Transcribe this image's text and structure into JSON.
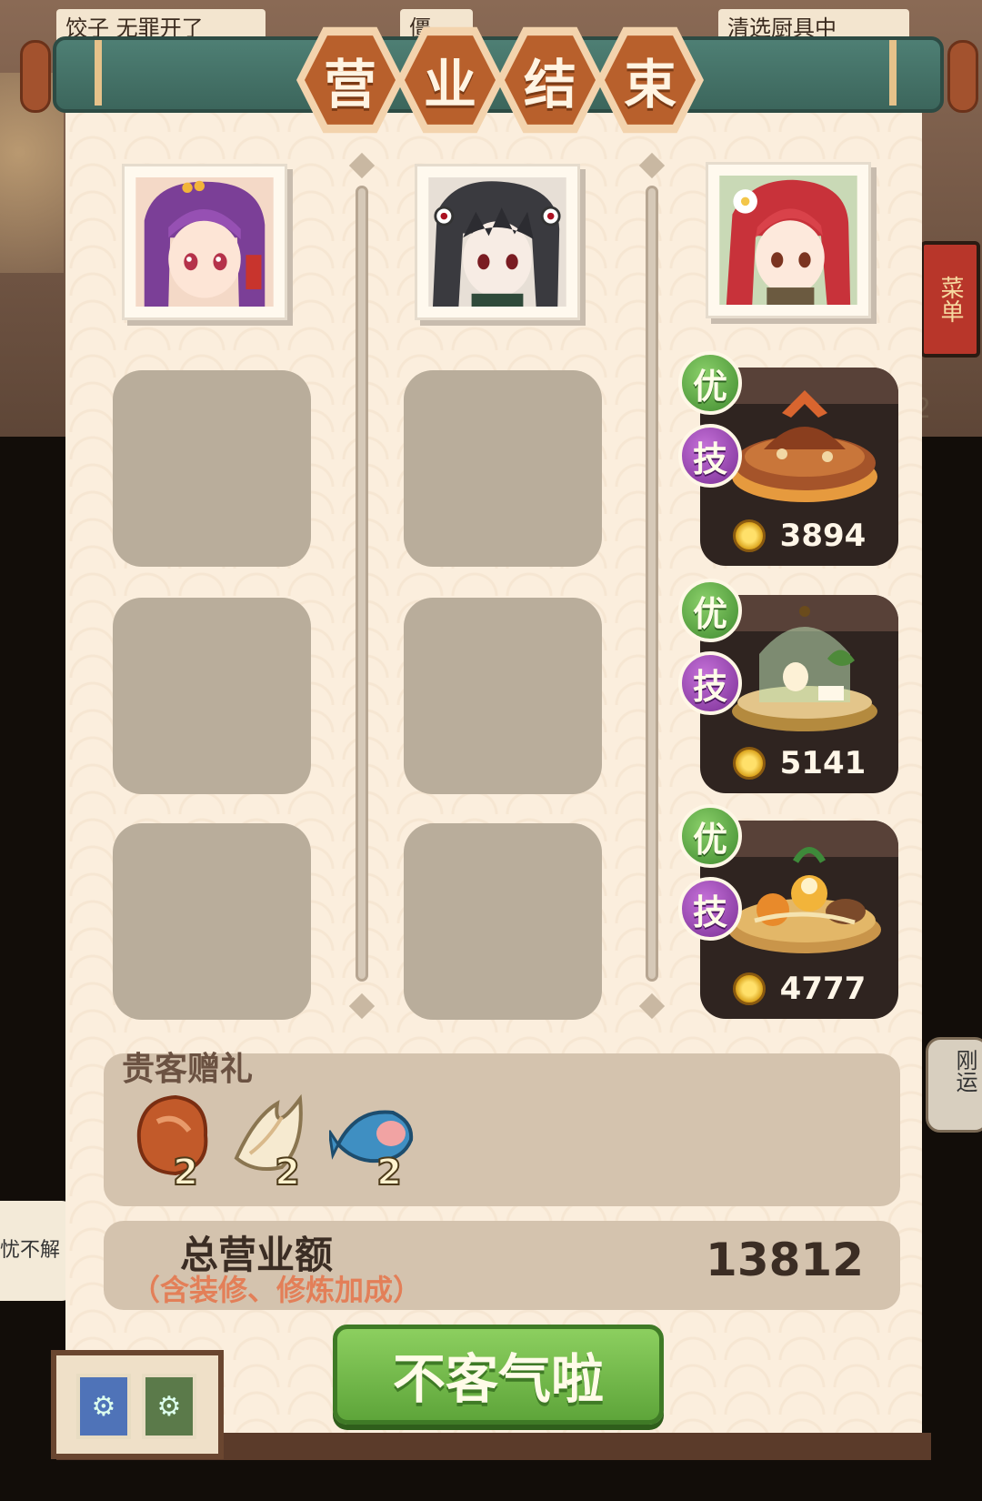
{
  "title": {
    "chars": [
      "营",
      "业",
      "结",
      "束"
    ]
  },
  "background": {
    "sign_left": "饺子 无罪开了",
    "sign_mid": "僵",
    "sign_right": "清选厨具中",
    "menu_sign": "菜单",
    "left_bubble": "忧不解",
    "right_bubble": "刚运",
    "right_number": "2"
  },
  "staff": [
    {
      "name": "purple-haired-chef"
    },
    {
      "name": "dark-haired-chef"
    },
    {
      "name": "red-haired-chef"
    }
  ],
  "dishes": [
    {
      "badge_quality": "优",
      "badge_skill": "技",
      "value": "3894",
      "icon": "braised-fish-hotpot-icon"
    },
    {
      "badge_quality": "优",
      "badge_skill": "技",
      "value": "5141",
      "icon": "glass-dome-dessert-icon"
    },
    {
      "badge_quality": "优",
      "badge_skill": "技",
      "value": "4777",
      "icon": "seafood-platter-icon"
    }
  ],
  "gifts": {
    "title": "贵客赠礼",
    "items": [
      {
        "icon": "meat-chunk-icon",
        "count": "2"
      },
      {
        "icon": "fin-icon",
        "count": "2"
      },
      {
        "icon": "blue-fish-icon",
        "count": "2"
      }
    ]
  },
  "revenue": {
    "label": "总营业额",
    "note": "（含装修、修炼加成）",
    "value": "13812"
  },
  "confirm_label": "不客气啦",
  "colors": {
    "panel": "#fbeedd",
    "title_bar": "#4e7f74",
    "hex_tile": "#b8602c",
    "button": "#6fb847",
    "badge_you": "#4f9a38",
    "badge_ji": "#8a3aa6"
  }
}
